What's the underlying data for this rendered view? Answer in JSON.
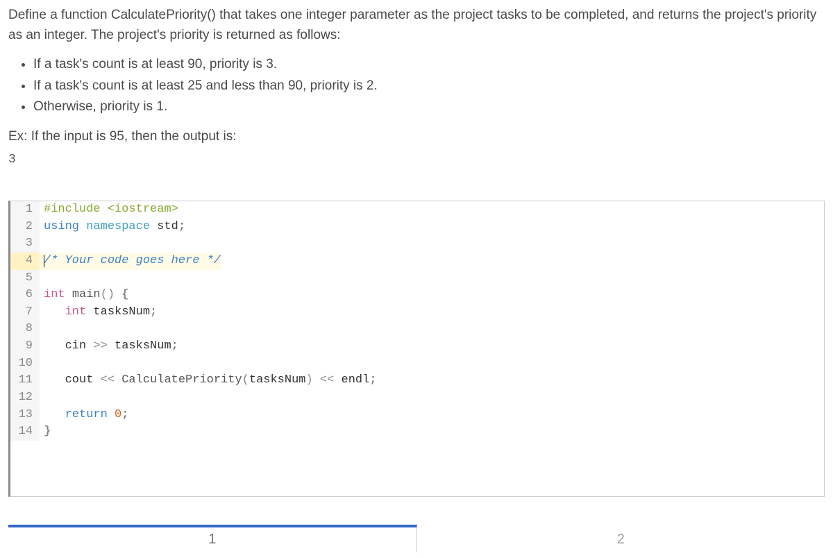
{
  "problem": {
    "para1": "Define a function CalculatePriority() that takes one integer parameter as the project tasks to be completed, and returns the project's priority as an integer. The project's priority is returned as follows:",
    "bullets": [
      "If a task's count is at least 90, priority is 3.",
      "If a task's count is at least 25 and less than 90, priority is 2.",
      "Otherwise, priority is 1."
    ],
    "example_intro": "Ex: If the input is 95, then the output is:",
    "example_output": "3"
  },
  "code": {
    "lines": [
      {
        "n": 1,
        "tokens": [
          {
            "t": "#include ",
            "c": "kw-preproc"
          },
          {
            "t": "<iostream>",
            "c": "kw-preproc"
          }
        ]
      },
      {
        "n": 2,
        "tokens": [
          {
            "t": "using ",
            "c": "kw-using"
          },
          {
            "t": "namespace ",
            "c": "kw-ns"
          },
          {
            "t": "std",
            "c": "kw-str"
          },
          {
            "t": ";",
            "c": "kw-sym"
          }
        ]
      },
      {
        "n": 3,
        "tokens": []
      },
      {
        "n": 4,
        "active": true,
        "tokens": [
          {
            "t": "/* Your code goes here */",
            "c": "kw-comment"
          }
        ]
      },
      {
        "n": 5,
        "tokens": []
      },
      {
        "n": 6,
        "tokens": [
          {
            "t": "int ",
            "c": "kw-type"
          },
          {
            "t": "main",
            "c": "kw-fn"
          },
          {
            "t": "() ",
            "c": "kw-paren"
          },
          {
            "t": "{",
            "c": "kw-brace"
          }
        ]
      },
      {
        "n": 7,
        "tokens": [
          {
            "t": "   ",
            "c": ""
          },
          {
            "t": "int ",
            "c": "kw-type"
          },
          {
            "t": "tasksNum",
            "c": "kw-str"
          },
          {
            "t": ";",
            "c": "kw-sym"
          }
        ]
      },
      {
        "n": 8,
        "tokens": []
      },
      {
        "n": 9,
        "tokens": [
          {
            "t": "   cin ",
            "c": "kw-str"
          },
          {
            "t": ">> ",
            "c": "kw-op"
          },
          {
            "t": "tasksNum",
            "c": "kw-str"
          },
          {
            "t": ";",
            "c": "kw-sym"
          }
        ]
      },
      {
        "n": 10,
        "tokens": []
      },
      {
        "n": 11,
        "tokens": [
          {
            "t": "   cout ",
            "c": "kw-str"
          },
          {
            "t": "<< ",
            "c": "kw-op"
          },
          {
            "t": "CalculatePriority",
            "c": "kw-fn"
          },
          {
            "t": "(",
            "c": "kw-paren"
          },
          {
            "t": "tasksNum",
            "c": "kw-str"
          },
          {
            "t": ") ",
            "c": "kw-paren"
          },
          {
            "t": "<< ",
            "c": "kw-op"
          },
          {
            "t": "endl",
            "c": "kw-str"
          },
          {
            "t": ";",
            "c": "kw-sym"
          }
        ]
      },
      {
        "n": 12,
        "tokens": []
      },
      {
        "n": 13,
        "tokens": [
          {
            "t": "   ",
            "c": ""
          },
          {
            "t": "return ",
            "c": "kw-using"
          },
          {
            "t": "0",
            "c": "kw-num"
          },
          {
            "t": ";",
            "c": "kw-sym"
          }
        ]
      },
      {
        "n": 14,
        "tokens": [
          {
            "t": "}",
            "c": "kw-brace"
          }
        ]
      }
    ]
  },
  "pager": {
    "tabs": [
      {
        "label": "1",
        "active": true
      },
      {
        "label": "2",
        "active": false
      }
    ]
  }
}
